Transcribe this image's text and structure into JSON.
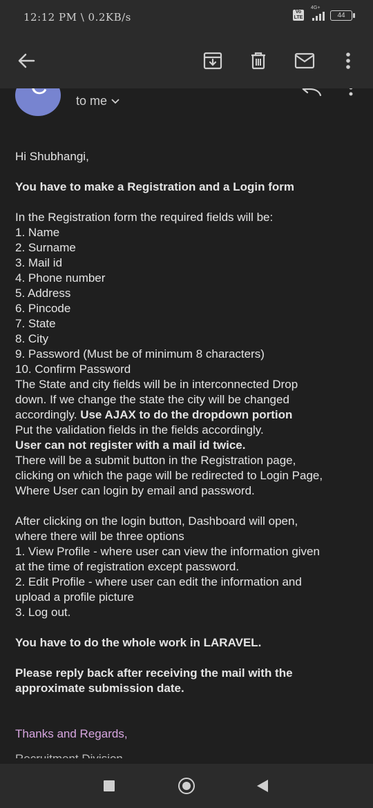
{
  "status_bar": {
    "time": "12:12 PM \\ 0.2KB/s",
    "volte": "Vo LTE",
    "network": "4G+",
    "battery": "44"
  },
  "toolbar": {
    "back_icon": "arrow-left-icon",
    "archive_icon": "archive-icon",
    "delete_icon": "trash-icon",
    "mark_unread_icon": "mail-icon",
    "more_icon": "more-vertical-icon"
  },
  "sender": {
    "avatar_letter": "C",
    "avatar_color": "#7784d0",
    "recipient": "to me"
  },
  "email": {
    "lines": [
      {
        "text": "Hi Shubhangi,"
      },
      {
        "text": ""
      },
      {
        "text": "You have to make a Registration and a Login form",
        "bold": true
      },
      {
        "text": ""
      },
      {
        "text": "In the Registration form the required fields will be:"
      },
      {
        "text": "1. Name"
      },
      {
        "text": "2. Surname"
      },
      {
        "text": "3. Mail id"
      },
      {
        "text": "4. Phone number"
      },
      {
        "text": "5. Address"
      },
      {
        "text": "6. Pincode"
      },
      {
        "text": "7. State"
      },
      {
        "text": "8. City"
      },
      {
        "text": "9. Password (Must be of minimum 8 characters)"
      },
      {
        "text": "10. Confirm Password"
      },
      {
        "text": "The State and city fields will be in interconnected Drop"
      },
      {
        "text": "down. If we change the state the city will be changed"
      },
      {
        "text": "accordingly. ",
        "bold_tail": "Use AJAX to do the dropdown portion"
      },
      {
        "text": "Put the validation fields in the fields accordingly."
      },
      {
        "text": "User can not register with a mail id twice.",
        "bold": true
      },
      {
        "text": "There will be a submit button in the Registration page,"
      },
      {
        "text": "clicking on which the page will be redirected to Login Page,"
      },
      {
        "text": "Where User can login by email and password."
      },
      {
        "text": ""
      },
      {
        "text": "After clicking on the login button, Dashboard will open,"
      },
      {
        "text": "where there will be three options"
      },
      {
        "text": "1. View Profile - where user can view the information given"
      },
      {
        "text": "at the time of registration except password."
      },
      {
        "text": "2. Edit Profile - where user can edit the information and"
      },
      {
        "text": "upload a profile picture"
      },
      {
        "text": "3. Log out."
      },
      {
        "text": ""
      },
      {
        "text": "You have to do the whole work in LARAVEL.",
        "bold": true
      },
      {
        "text": ""
      },
      {
        "text": "Please reply back after receiving the mail with the",
        "bold": true
      },
      {
        "text": "approximate submission date.",
        "bold": true
      },
      {
        "text": ""
      },
      {
        "text": ""
      }
    ],
    "signature": "Thanks and Regards,",
    "signature_color": "#d7a6e0",
    "signature_cut": "Recruitment Division"
  },
  "nav": {
    "recents_icon": "square-icon",
    "home_icon": "circle-icon",
    "back_icon": "triangle-back-icon"
  }
}
